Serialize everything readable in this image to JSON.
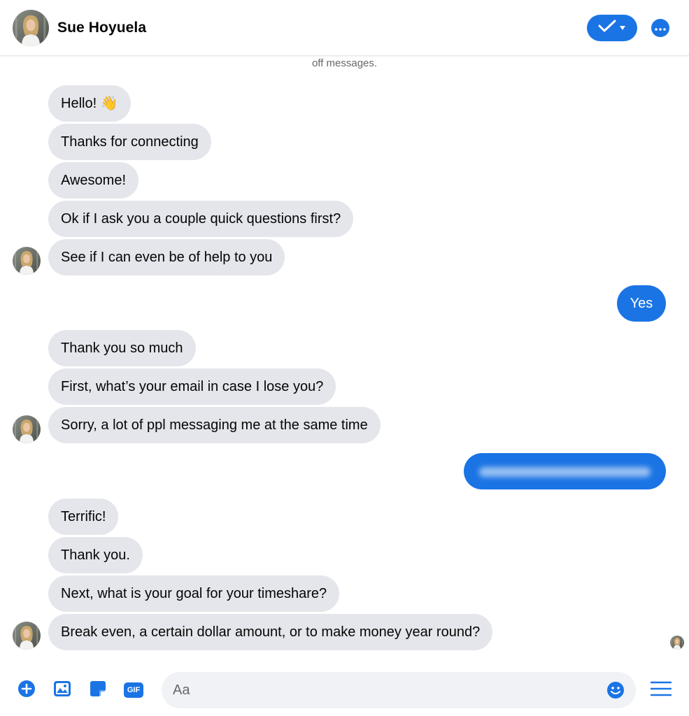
{
  "header": {
    "contact_name": "Sue Hoyuela"
  },
  "thread": {
    "notice": "off messages.",
    "messages": [
      {
        "from": "them",
        "text": "Hello! 👋"
      },
      {
        "from": "them",
        "text": "Thanks for connecting"
      },
      {
        "from": "them",
        "text": "Awesome!"
      },
      {
        "from": "them",
        "text": "Ok if I ask you a couple quick questions first?"
      },
      {
        "from": "them",
        "text": "See if I can even be of help to you"
      },
      {
        "from": "me",
        "text": "Yes"
      },
      {
        "from": "them",
        "text": "Thank you so much"
      },
      {
        "from": "them",
        "text": "First, what’s your email in case I lose you?"
      },
      {
        "from": "them",
        "text": "Sorry, a lot of ppl messaging me at the same time"
      },
      {
        "from": "me",
        "text": "",
        "redacted": true
      },
      {
        "from": "them",
        "text": "Terrific!"
      },
      {
        "from": "them",
        "text": "Thank you."
      },
      {
        "from": "them",
        "text": "Next, what is your goal for your timeshare?"
      },
      {
        "from": "them",
        "text": "Break even, a certain dollar amount, or to make money year round?"
      }
    ]
  },
  "composer": {
    "placeholder": "Aa",
    "gif_label": "GIF",
    "tools": [
      "plus-icon",
      "photo-icon",
      "sticker-icon",
      "gif-icon"
    ]
  },
  "colors": {
    "accent": "#1b74e4",
    "incoming_bubble": "#e4e6eb",
    "composer_bg": "#f0f2f5"
  }
}
